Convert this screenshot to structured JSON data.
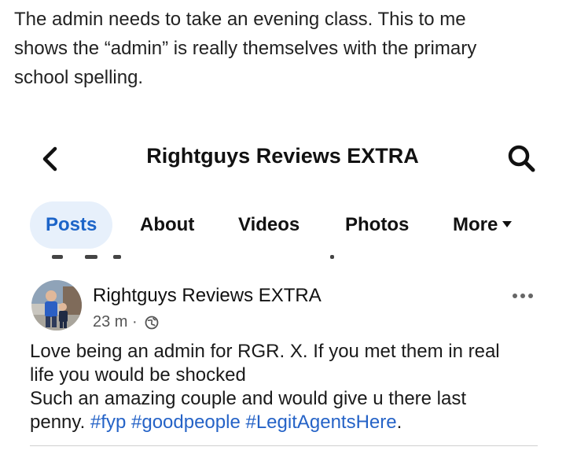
{
  "caption": {
    "lines": [
      "The admin needs to take an evening class. This to me",
      "shows the “admin” is really themselves with the primary",
      "school spelling."
    ]
  },
  "header": {
    "back_icon": "chevron-left-icon",
    "title": "Rightguys Reviews EXTRA",
    "search_icon": "search-icon"
  },
  "tabs": [
    {
      "label": "Posts",
      "active": true
    },
    {
      "label": "About",
      "active": false
    },
    {
      "label": "Videos",
      "active": false
    },
    {
      "label": "Photos",
      "active": false
    },
    {
      "label": "More",
      "active": false
    }
  ],
  "post": {
    "author": "Rightguys Reviews EXTRA",
    "time": "23 m",
    "separator": "·",
    "audience_icon": "globe-icon",
    "more_icon": "more-horizontal-icon",
    "body": {
      "line1": "Love being an admin for RGR. X.  If you met them in real",
      "line2": "life you would be shocked",
      "line3": "Such an amazing couple and would give u there last",
      "line4_prefix": "penny. ",
      "hashtags": [
        "#fyp",
        "#goodpeople",
        "#LegitAgentsHere"
      ],
      "line4_suffix": "."
    }
  },
  "colors": {
    "accent": "#1c64c8",
    "tab_active_bg": "#e7f0fb",
    "hashtag": "#2563c7"
  }
}
